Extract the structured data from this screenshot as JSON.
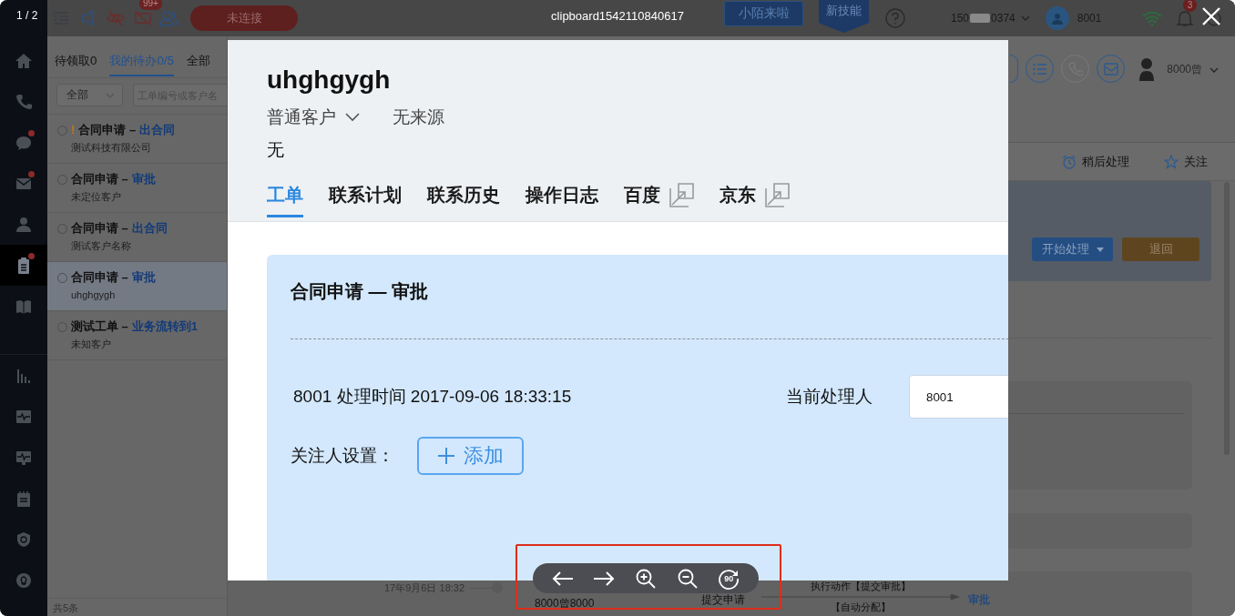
{
  "viewer": {
    "counter": "1 / 2",
    "filename": "clipboard1542110840617",
    "rotate_label": "90"
  },
  "topbar": {
    "notification_count": "99+",
    "connection_button": "未连接",
    "banners": [
      "小陌来啦",
      "新技能"
    ],
    "phone_prefix": "150",
    "phone_suffix": "0374",
    "agent": "8001",
    "alert_count": "3"
  },
  "nav": {
    "primary": [
      {
        "selected": false,
        "badge": false
      },
      {
        "selected": false,
        "badge": false
      },
      {
        "selected": false,
        "badge": true
      },
      {
        "selected": false,
        "badge": true
      },
      {
        "selected": false,
        "badge": false
      },
      {
        "selected": true,
        "badge": true
      },
      {
        "selected": false,
        "badge": false
      }
    ],
    "secondary": [
      {
        "selected": false,
        "badge": false
      },
      {
        "selected": false,
        "badge": false
      },
      {
        "selected": false,
        "badge": false
      },
      {
        "selected": false,
        "badge": false
      },
      {
        "selected": false,
        "badge": false
      },
      {
        "selected": false,
        "badge": false
      }
    ]
  },
  "task_list": {
    "tabs": [
      {
        "label": "待领取0",
        "selected": false
      },
      {
        "label": "我的待办0/5",
        "selected": true
      },
      {
        "label": "全部",
        "selected": false
      }
    ],
    "filter": "全部",
    "search_placeholder": "工单编号或客户名",
    "items": [
      {
        "flag": "!",
        "title": "合同申请 –",
        "stage": "出合同",
        "customer": "测试科技有限公司",
        "selected": false
      },
      {
        "title": "合同申请 –",
        "stage": "审批",
        "customer": "未定位客户",
        "selected": false
      },
      {
        "title": "合同申请 –",
        "stage": "出合同",
        "customer": "测试客户名称",
        "selected": false
      },
      {
        "title": "合同申请 –",
        "stage": "审批",
        "customer": "uhghgygh",
        "selected": true
      },
      {
        "title": "测试工单 –",
        "stage": "业务流转到1",
        "customer": "未知客户",
        "selected": false
      }
    ],
    "footer": "共5条"
  },
  "main": {
    "user": "8000曾",
    "later": "稍后处理",
    "follow": "关注",
    "start_button": "开始处理",
    "return_button": "退回",
    "timeline": {
      "time": "17年9月6日 18:32",
      "actor": "8000曾8000",
      "event": "提交申请",
      "action": "执行动作【提交审批】",
      "assign": "【自动分配】",
      "result": "审批"
    }
  },
  "screenshot": {
    "customer_name": "uhghgygh",
    "customer_type": "普通客户",
    "source": "无来源",
    "remark": "无",
    "tabs": [
      {
        "label": "工单",
        "selected": true,
        "external": false
      },
      {
        "label": "联系计划",
        "selected": false,
        "external": false
      },
      {
        "label": "联系历史",
        "selected": false,
        "external": false
      },
      {
        "label": "操作日志",
        "selected": false,
        "external": false
      },
      {
        "label": "百度",
        "selected": false,
        "external": true
      },
      {
        "label": "京东",
        "selected": false,
        "external": true
      }
    ],
    "card": {
      "title": "合同申请 — 审批",
      "processing": "8001 处理时间 2017-09-06 18:33:15",
      "assignee_label": "当前处理人",
      "assignee": "8001",
      "followers_label": "关注人设置：",
      "add_button": "添加"
    }
  }
}
